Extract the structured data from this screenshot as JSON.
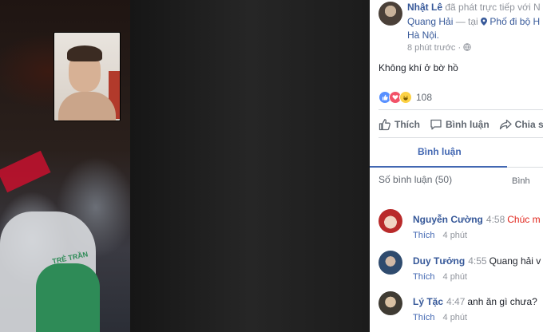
{
  "post": {
    "author": "Nhật Lê",
    "action": "đã phát trực tiếp với N",
    "with_name": "Quang Hải",
    "at_sep": "— tại",
    "location_pin": "pin-icon",
    "location": "Phố đi bộ H",
    "location_cont": "Hà Nội.",
    "time": "8 phút trước",
    "dot": "·",
    "text": "Không khí ở bờ hồ",
    "reaction_count": "108"
  },
  "actions": {
    "like": "Thích",
    "comment": "Bình luận",
    "share": "Chia s"
  },
  "tabs": {
    "comments": "Bình luận"
  },
  "comments_header": {
    "count": "Số bình luận (50)",
    "sort": "Bình"
  },
  "comments": [
    {
      "name": "Nguyễn Cường",
      "time": "4:58",
      "text": "Chúc m",
      "like": "Thích",
      "ago": "4 phút",
      "text_color": "#e1251b"
    },
    {
      "name": "Duy Tưởng",
      "time": "4:55",
      "text": "Quang hải v",
      "like": "Thích",
      "ago": "4 phút"
    },
    {
      "name": "Lý Tặc",
      "time": "4:47",
      "text": "anh ăn gì chưa?",
      "like": "Thích",
      "ago": "4 phút"
    }
  ],
  "video": {
    "shirt_text": "TRẺ TRẦN"
  },
  "colors": {
    "link": "#365899",
    "accent": "#4267b2",
    "muted": "#90949c"
  }
}
